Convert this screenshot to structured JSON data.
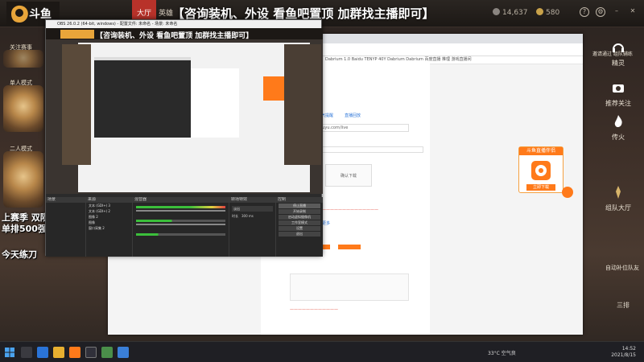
{
  "topbar": {
    "tab_hall": "大厅",
    "tab_hero": "英雄",
    "title": "【咨询装机、外设 看鱼吧置顶 加群找主播即可】",
    "currency_a": "14,637",
    "currency_b": "580"
  },
  "left": {
    "item1": "关注赛事",
    "item2": "单人模式",
    "item3": "二人模式",
    "season_line1": "上赛季 双陨星",
    "season_line2": "单排500强",
    "today_line": "今天练刀"
  },
  "right": {
    "btn_spirit": "精灵",
    "btn_camera": "推荐关注",
    "btn_fire": "传火",
    "btn_team": "组队大厅",
    "auto_match": "自动补位队友",
    "three": "三排",
    "notice": "邀请通过 组队辅练"
  },
  "obs": {
    "window_title": "OBS 26.0.2 (64-bit, windows) - 配置文件: 未命名 - 场景: 未命名",
    "preview_title": "【咨询装机、外设 看鱼吧置顶 加群找主播即可】",
    "dock_scenes": "场景",
    "dock_sources": "来源",
    "dock_mixer": "混音器",
    "dock_transitions": "转场特效",
    "dock_controls": "控制",
    "sources": [
      "文本 (GDI+) 3",
      "文本 (GDI+) 2",
      "图像 2",
      "图像",
      "窗口采集 2"
    ],
    "controls": [
      "停止直播",
      "开始录制",
      "启动虚拟摄像机",
      "工作室模式",
      "设置",
      "退出"
    ],
    "transition_value": "淡出",
    "duration_label": "时长",
    "duration_value": "300 ms",
    "status": "LIVE: 00:34:18  REC: 00:00:00  CPU: 5.4%, 60.00 fps"
  },
  "browser": {
    "bookmarks": "Dabrium 1.0  Baidu  TENYP 40Y  Dabrium  Dabrium  百度直播 推理  游戏直播间",
    "nav_links": [
      "选项",
      "鱼吧"
    ],
    "sponsor_title": "斗鱼直播伴侣",
    "sponsor_btn": "立即下载",
    "links": [
      "人气提醒",
      "直播回放",
      "查看更多"
    ],
    "url_hint": "douyu.com/live",
    "dialog_label": "确认下载"
  },
  "taskbar": {
    "weather": "33°C 空气良",
    "time": "14:52",
    "date": "2021/8/15"
  },
  "colors": {
    "accent_red": "#b8322a",
    "orange": "#ff7a1a",
    "link_blue": "#2a74d8"
  }
}
